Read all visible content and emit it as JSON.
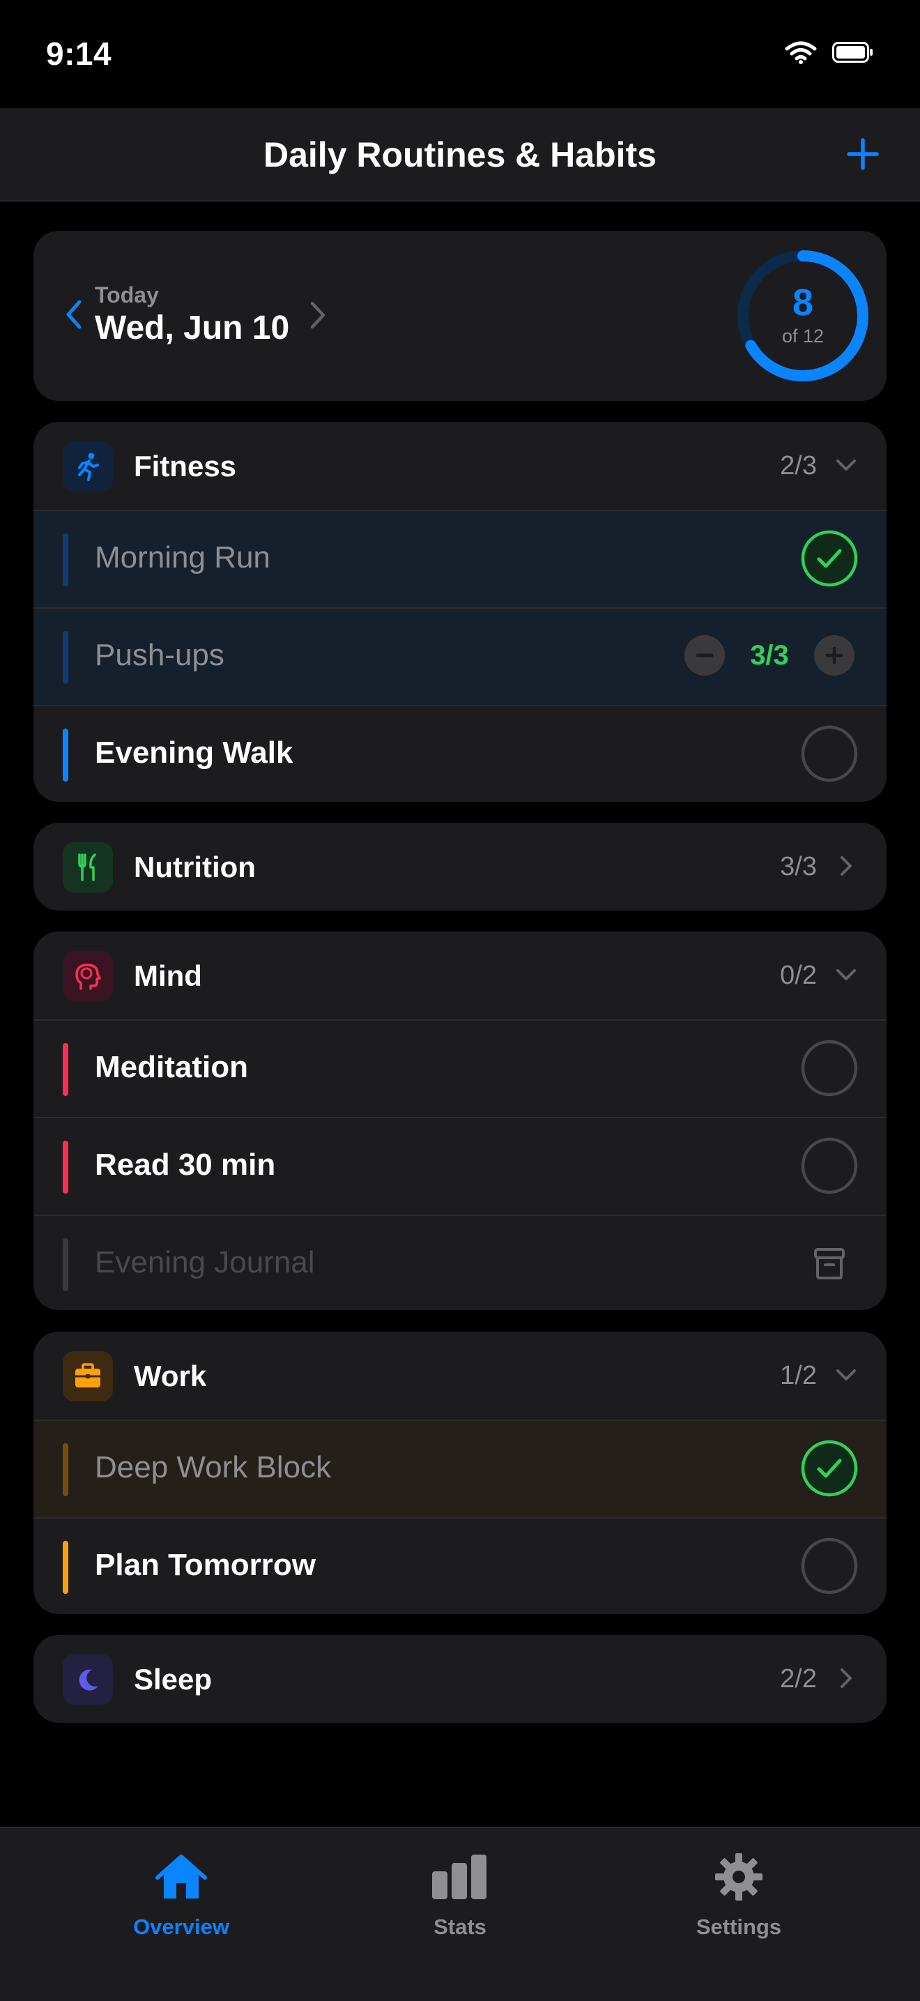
{
  "status_bar": {
    "time": "9:14"
  },
  "nav": {
    "title": "Daily Routines & Habits",
    "add_icon": "plus-icon"
  },
  "date_card": {
    "label": "Today",
    "date": "Wed, Jun 10",
    "progress": {
      "completed": "8",
      "total_label": "of 12",
      "fraction": 0.667
    }
  },
  "colors": {
    "accent": "#0a84ff",
    "success": "#30d158",
    "fitness": "#0a84ff",
    "nutrition": "#30d158",
    "mind": "#ff2d55",
    "work": "#ff9f0a",
    "sleep": "#5e5ce6"
  },
  "sections": {
    "fitness": {
      "name": "Fitness",
      "count": "2/3",
      "icon": "runner-icon",
      "items": [
        {
          "name": "Morning Run",
          "state": "done"
        },
        {
          "name": "Push-ups",
          "state": "stepper",
          "value": "3/3"
        },
        {
          "name": "Evening Walk",
          "state": "todo"
        }
      ]
    },
    "nutrition": {
      "name": "Nutrition",
      "count": "3/3",
      "icon": "fork-knife-icon"
    },
    "mind": {
      "name": "Mind",
      "count": "0/2",
      "icon": "brain-head-icon",
      "items": [
        {
          "name": "Meditation",
          "state": "todo"
        },
        {
          "name": "Read 30 min",
          "state": "todo"
        },
        {
          "name": "Evening Journal",
          "state": "archived"
        }
      ]
    },
    "work": {
      "name": "Work",
      "count": "1/2",
      "icon": "briefcase-icon",
      "items": [
        {
          "name": "Deep Work Block",
          "state": "done"
        },
        {
          "name": "Plan Tomorrow",
          "state": "todo"
        }
      ]
    },
    "sleep": {
      "name": "Sleep",
      "count": "2/2",
      "icon": "moon-icon"
    }
  },
  "tabs": [
    {
      "label": "Overview",
      "icon": "house-icon",
      "active": true
    },
    {
      "label": "Stats",
      "icon": "bar-chart-icon",
      "active": false
    },
    {
      "label": "Settings",
      "icon": "gear-icon",
      "active": false
    }
  ]
}
